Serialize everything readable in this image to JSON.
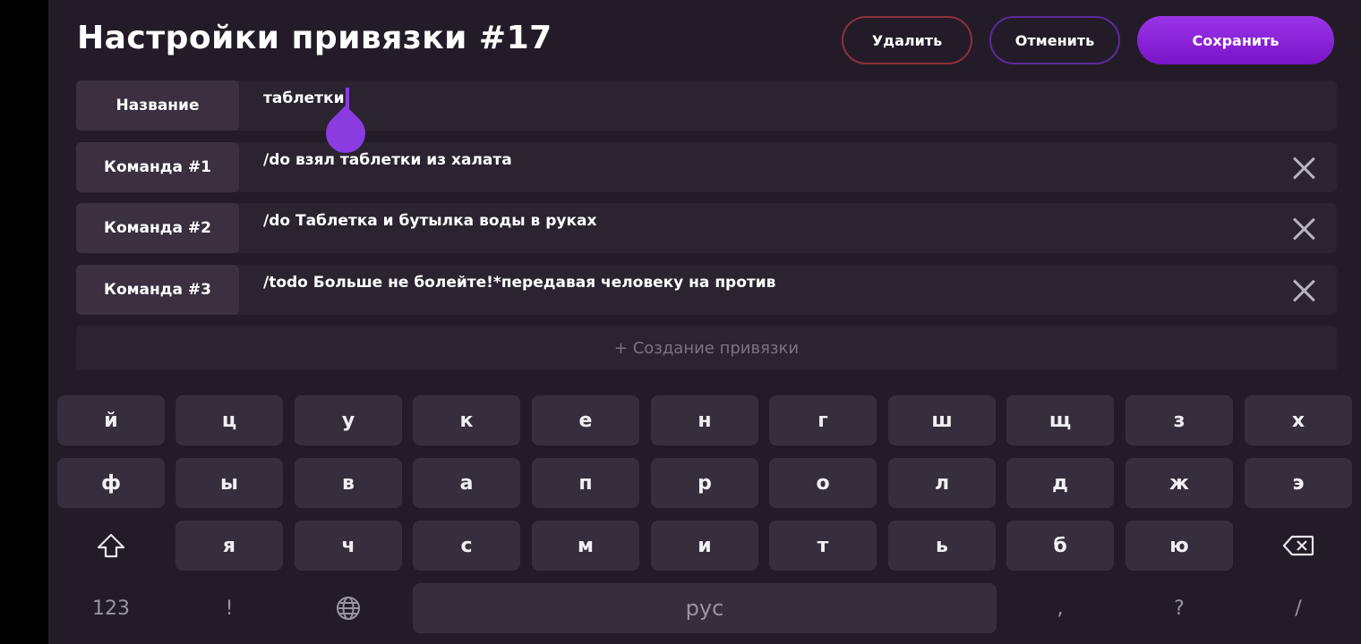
{
  "header": {
    "title": "Настройки привязки #17",
    "delete_label": "Удалить",
    "cancel_label": "Отменить",
    "save_label": "Сохранить"
  },
  "fields": {
    "name": {
      "label": "Название",
      "value": "таблетки"
    },
    "commands": [
      {
        "label": "Команда #1",
        "value": "/do взял таблетки из халата"
      },
      {
        "label": "Команда #2",
        "value": "/do Таблетка и бутылка воды в руках"
      },
      {
        "label": "Команда #3",
        "value": "/todo Больше не болейте!*передавая человеку на против"
      }
    ],
    "add_label": "+ Создание привязки"
  },
  "keyboard": {
    "row1": [
      "й",
      "ц",
      "у",
      "к",
      "е",
      "н",
      "г",
      "ш",
      "щ",
      "з",
      "х"
    ],
    "row2": [
      "ф",
      "ы",
      "в",
      "а",
      "п",
      "р",
      "о",
      "л",
      "д",
      "ж",
      "э"
    ],
    "row3": [
      "я",
      "ч",
      "с",
      "м",
      "и",
      "т",
      "ь",
      "б",
      "ю"
    ],
    "numbers_label": "123",
    "exclaim_label": "!",
    "space_label": "рус",
    "comma_label": ",",
    "question_label": "?",
    "slash_label": "/",
    "icons": {
      "shift": "shift-icon",
      "backspace": "backspace-icon",
      "language": "globe-icon",
      "close": "close-icon"
    }
  },
  "colors": {
    "background": "#231c28",
    "accent": "#8a3ce0",
    "delete_border": "#8e3039",
    "cancel_border": "#5a2a9a"
  }
}
